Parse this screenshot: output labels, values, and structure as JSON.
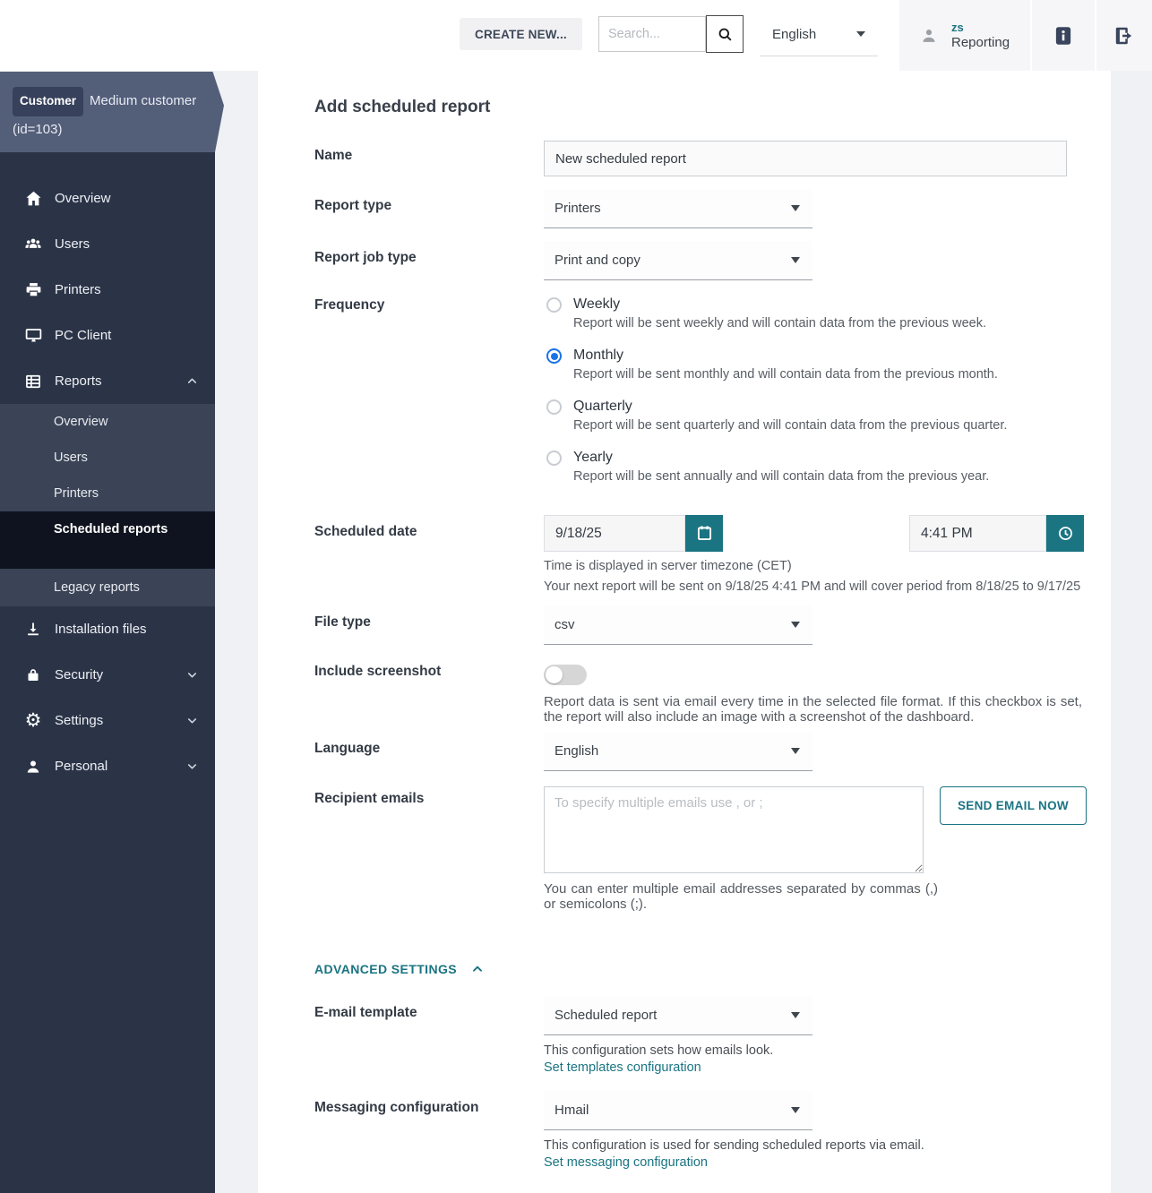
{
  "header": {
    "create_new_label": "CREATE NEW...",
    "search_placeholder": "Search...",
    "language_value": "English",
    "user_initials": "zs",
    "user_role": "Reporting"
  },
  "customer_banner": {
    "badge_label": "Customer",
    "name": "Medium customer",
    "id_text": "(id=103)"
  },
  "sidebar": {
    "items": [
      {
        "label": "Overview",
        "icon": "home-icon"
      },
      {
        "label": "Users",
        "icon": "users-icon"
      },
      {
        "label": "Printers",
        "icon": "printer-icon"
      },
      {
        "label": "PC Client",
        "icon": "monitor-icon"
      },
      {
        "label": "Reports",
        "icon": "reports-icon",
        "expanded": true
      },
      {
        "label": "Installation files",
        "icon": "download-icon"
      },
      {
        "label": "Security",
        "icon": "lock-icon",
        "collapsible": true
      },
      {
        "label": "Settings",
        "icon": "gear-icon",
        "collapsible": true
      },
      {
        "label": "Personal",
        "icon": "person-icon",
        "collapsible": true
      }
    ],
    "reports_children": [
      {
        "label": "Overview",
        "selected": false
      },
      {
        "label": "Users",
        "selected": false
      },
      {
        "label": "Printers",
        "selected": false
      },
      {
        "label": "Scheduled reports",
        "selected": true
      },
      {
        "label": "Legacy reports",
        "selected": false
      }
    ]
  },
  "form": {
    "title": "Add scheduled report",
    "name": {
      "label": "Name",
      "value": "New scheduled report"
    },
    "report_type": {
      "label": "Report type",
      "value": "Printers"
    },
    "report_job_type": {
      "label": "Report job type",
      "value": "Print and copy"
    },
    "frequency": {
      "label": "Frequency",
      "options": [
        {
          "label": "Weekly",
          "description": "Report will be sent weekly and will contain data from the previous week.",
          "selected": false
        },
        {
          "label": "Monthly",
          "description": "Report will be sent monthly and will contain data from the previous month.",
          "selected": true
        },
        {
          "label": "Quarterly",
          "description": "Report will be sent quarterly and will contain data from the previous quarter.",
          "selected": false
        },
        {
          "label": "Yearly",
          "description": "Report will be sent annually and will contain data from the previous year.",
          "selected": false
        }
      ]
    },
    "scheduled_date": {
      "label": "Scheduled date",
      "date_value": "9/18/25",
      "time_value": "4:41 PM",
      "timezone_note": "Time is displayed in server timezone (CET)",
      "next_report_note": "Your next report will be sent on 9/18/25 4:41 PM and will cover period from 8/18/25 to 9/17/25"
    },
    "file_type": {
      "label": "File type",
      "value": "csv"
    },
    "include_screenshot": {
      "label": "Include screenshot",
      "enabled": false,
      "description": "Report data is sent via email every time in the selected file format. If this checkbox is set, the report will also include an image with a screenshot of the dashboard."
    },
    "language": {
      "label": "Language",
      "value": "English"
    },
    "recipient_emails": {
      "label": "Recipient emails",
      "placeholder": "To specify multiple emails use , or ;",
      "send_button_label": "SEND EMAIL NOW",
      "help_text": "You can enter multiple email addresses separated by commas (,) or semicolons (;)."
    },
    "advanced_settings": {
      "label": "ADVANCED SETTINGS",
      "expanded": true
    },
    "email_template": {
      "label": "E-mail template",
      "value": "Scheduled report",
      "help_text": "This configuration sets how emails look.",
      "link_label": "Set templates configuration"
    },
    "messaging_configuration": {
      "label": "Messaging configuration",
      "value": "Hmail",
      "help_text": "This configuration is used for sending scheduled reports via email.",
      "link_label": "Set messaging configuration"
    }
  },
  "colors": {
    "accent_teal": "#1a7482",
    "radio_selected_blue": "#1a73e8",
    "sidebar_bg": "#2b3447",
    "sidebar_submenu_bg": "#3b4356",
    "sidebar_selected_bg": "#0e131f",
    "customer_banner_bg": "#535e79",
    "page_bg": "#eff1f5"
  }
}
